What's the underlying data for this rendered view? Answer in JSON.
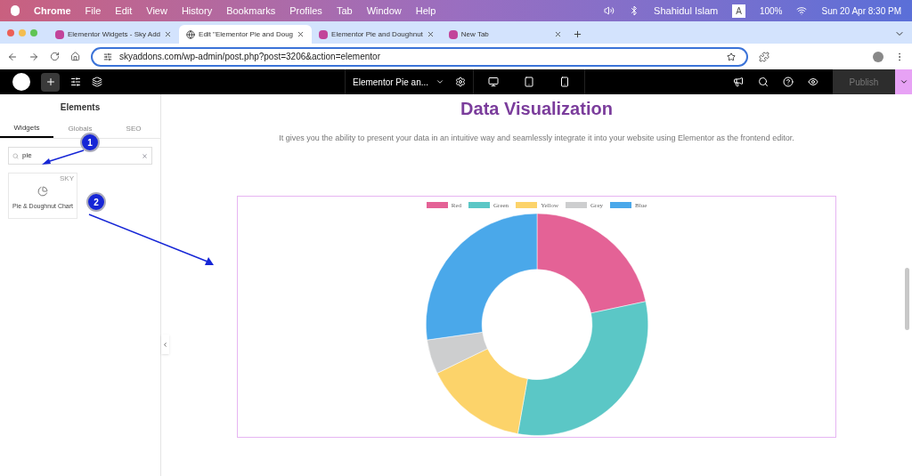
{
  "menu_bar": {
    "app": "Chrome",
    "items": [
      "File",
      "Edit",
      "View",
      "History",
      "Bookmarks",
      "Profiles",
      "Tab",
      "Window",
      "Help"
    ],
    "user": "Shahidul Islam",
    "input": "A",
    "battery": "100%",
    "clock": "Sun 20 Apr  8:30 PM"
  },
  "tabs": [
    {
      "title": "Elementor Widgets - Sky Add",
      "selected": false
    },
    {
      "title": "Edit \"Elementor Pie and Doug",
      "selected": true
    },
    {
      "title": "Elementor Pie and Doughnut",
      "selected": false
    },
    {
      "title": "New Tab",
      "selected": false
    }
  ],
  "address": "skyaddons.com/wp-admin/post.php?post=3206&action=elementor",
  "editor_bar": {
    "page_title": "Elementor Pie an...",
    "publish": "Publish"
  },
  "panel": {
    "title": "Elements",
    "tabs": [
      {
        "label": "Widgets",
        "selected": true
      },
      {
        "label": "Globals",
        "selected": false
      },
      {
        "label": "SEO",
        "selected": false
      }
    ],
    "search_value": "pie",
    "widget": {
      "label": "Pie & Doughnut Chart",
      "badge": "SKY"
    }
  },
  "annotations": [
    "1",
    "2"
  ],
  "page": {
    "heading": "Data Visualization",
    "text": "It gives you the ability to present your data in an intuitive way and seamlessly integrate it into your website using Elementor as the frontend editor.",
    "legend": [
      {
        "label": "Red",
        "color": "#e46296"
      },
      {
        "label": "Green",
        "color": "#5bc7c6"
      },
      {
        "label": "Yellow",
        "color": "#fcd36a"
      },
      {
        "label": "Grey",
        "color": "#cdcecf"
      },
      {
        "label": "Blue",
        "color": "#4aa8ea"
      }
    ]
  }
}
